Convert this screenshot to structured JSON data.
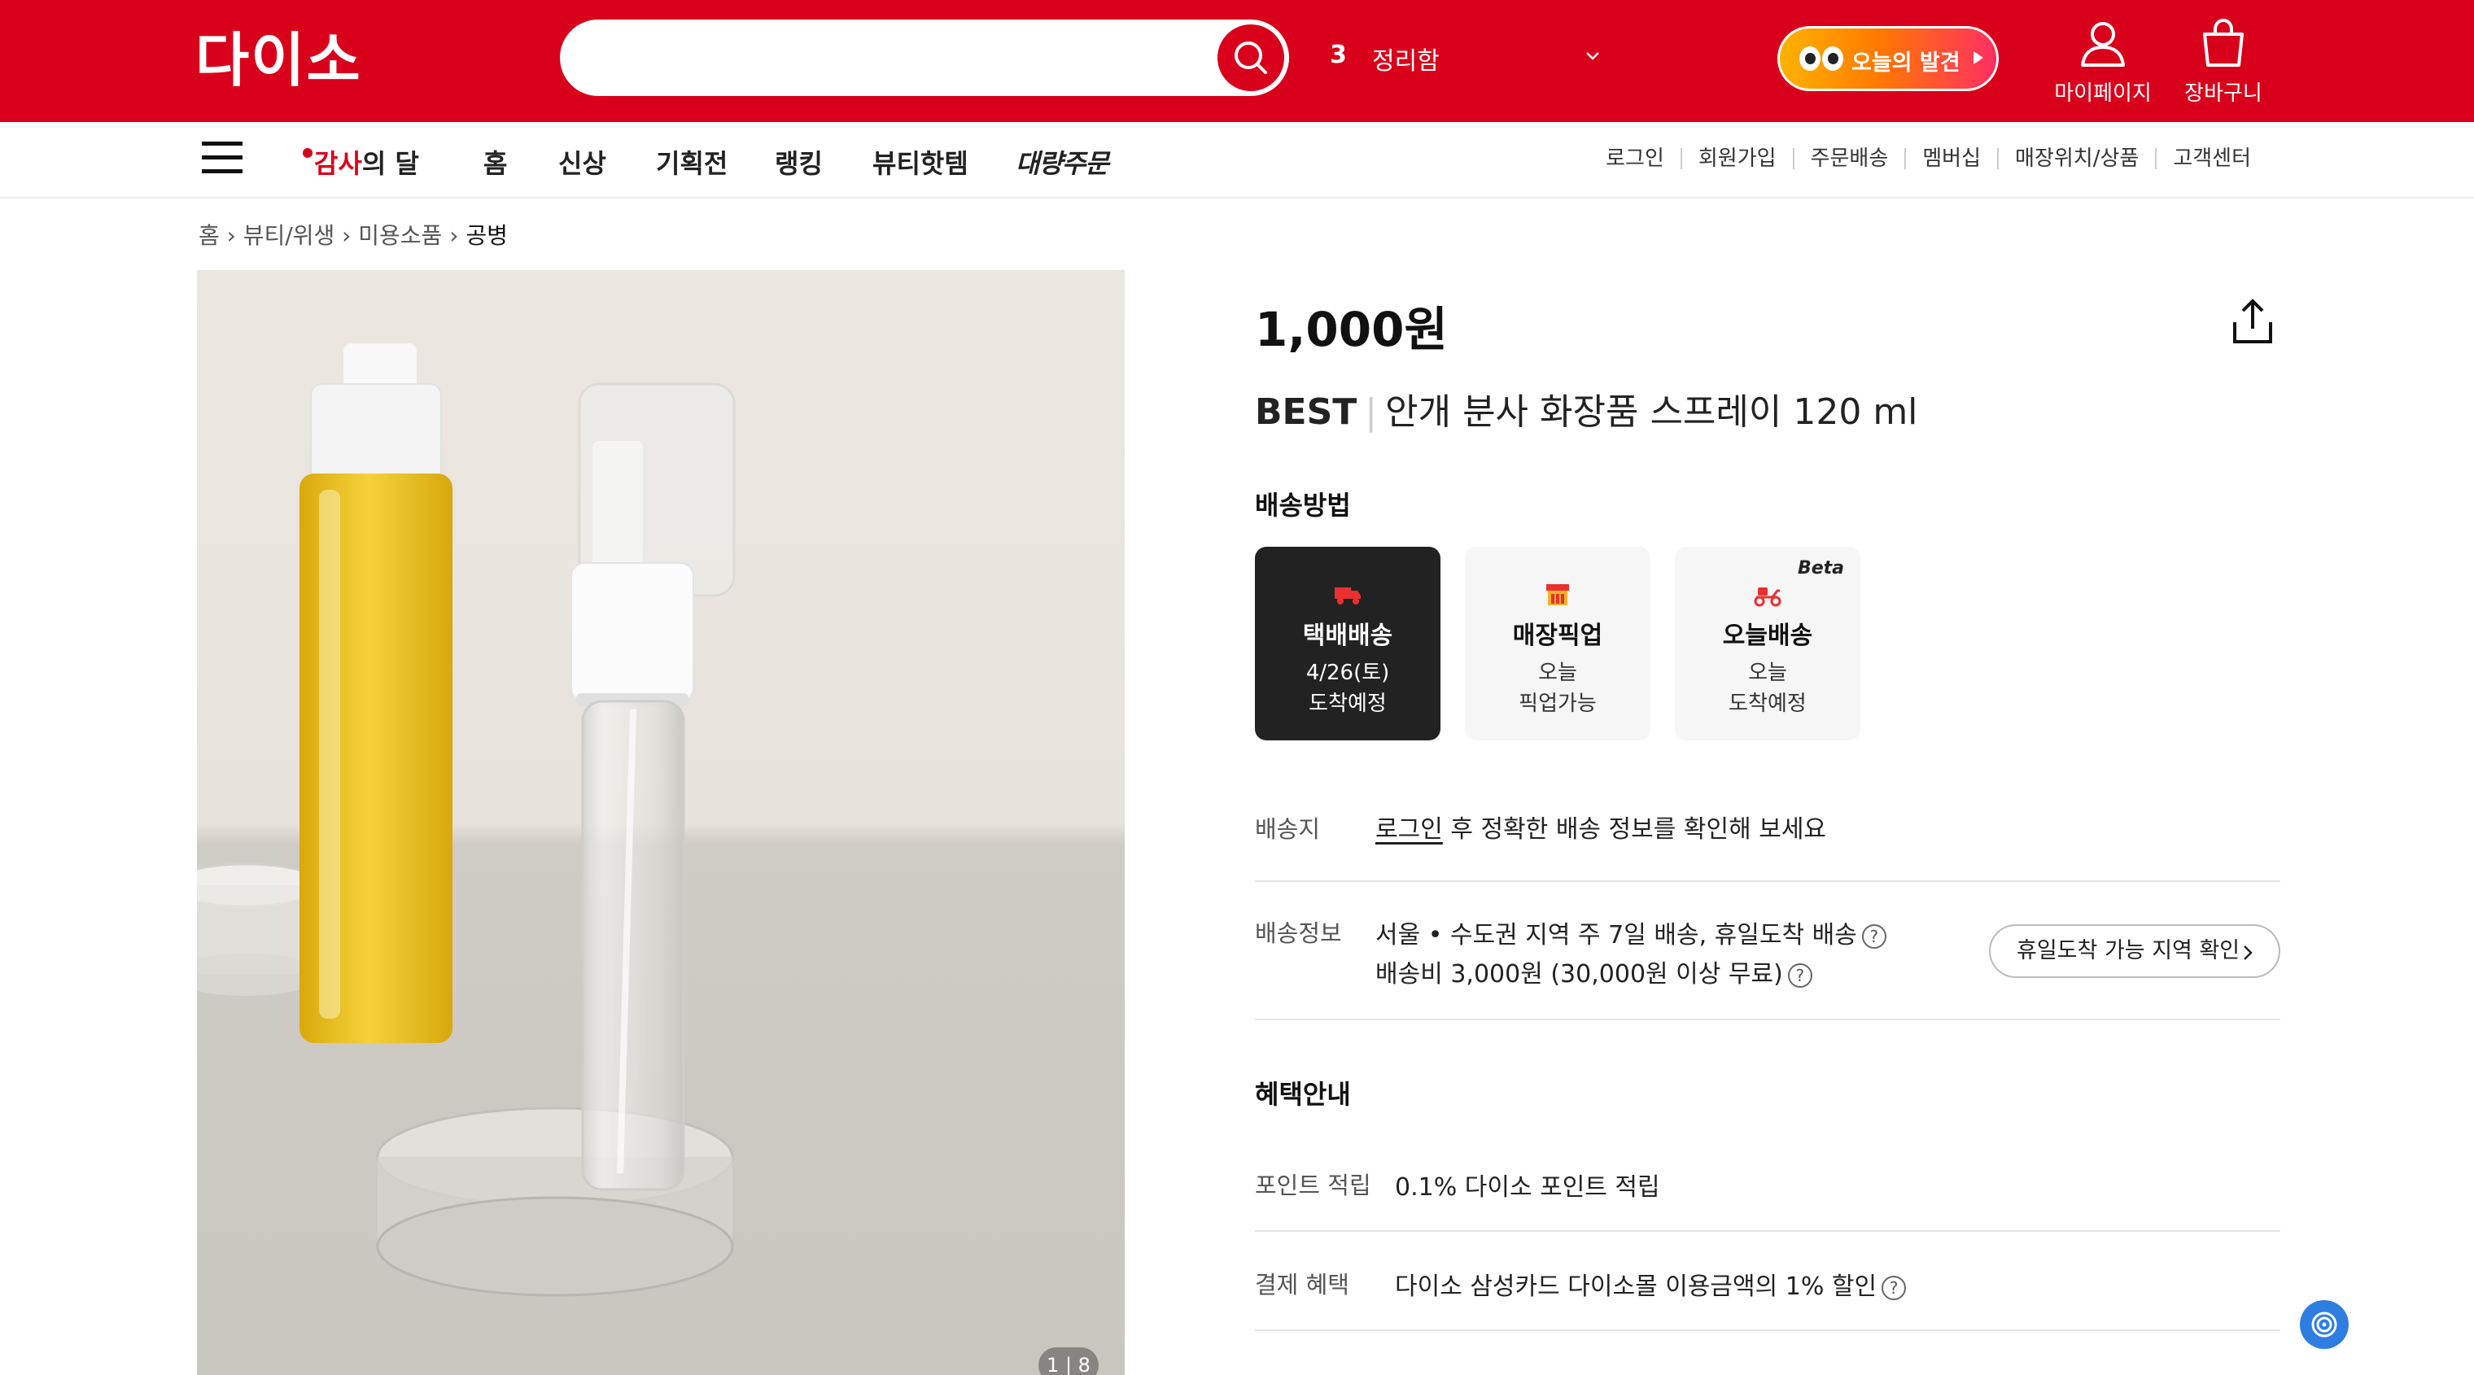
{
  "header": {
    "logo": "다이소",
    "search_placeholder": "",
    "rank_number": "3",
    "rank_keyword": "정리함",
    "today_badge": "오늘의 발견",
    "mypage": "마이페이지",
    "cart": "장바구니",
    "brand_color": "#d9001b"
  },
  "nav": {
    "promo_red": "감사",
    "promo_black": "의 달",
    "items": [
      "홈",
      "신상",
      "기획전",
      "랭킹",
      "뷰티핫템",
      "대량주문"
    ],
    "utility": [
      "로그인",
      "회원가입",
      "주문배송",
      "멤버십",
      "매장위치/상품",
      "고객센터"
    ]
  },
  "breadcrumb": [
    "홈",
    "뷰티/위생",
    "미용소품",
    "공병"
  ],
  "product": {
    "image_counter": "1 | 8",
    "price": "1,000원",
    "badge": "BEST",
    "name": "안개 분사 화장품 스프레이 120 ml"
  },
  "delivery": {
    "heading": "배송방법",
    "options": [
      {
        "name": "택배배송",
        "line1": "4/26(토)",
        "line2": "도착예정",
        "icon": "truck-icon",
        "active": true
      },
      {
        "name": "매장픽업",
        "line1": "오늘",
        "line2": "픽업가능",
        "icon": "store-icon",
        "active": false
      },
      {
        "name": "오늘배송",
        "line1": "오늘",
        "line2": "도착예정",
        "icon": "scooter-icon",
        "active": false,
        "tag": "Beta"
      }
    ],
    "dest_label": "배송지",
    "dest_link": "로그인",
    "dest_text": " 후 정확한 배송 정보를 확인해 보세요",
    "info_label": "배송정보",
    "info_line1": "서울 • 수도권 지역 주 7일 배송, 휴일도착 배송",
    "info_line2": "배송비 3,000원 (30,000원 이상 무료)",
    "holiday_button": "휴일도착 가능 지역 확인"
  },
  "benefits": {
    "heading": "혜택안내",
    "point_label": "포인트 적립",
    "point_text": "0.1% 다이소 포인트 적립",
    "pay_label": "결제 혜택",
    "pay_text": "다이소 삼성카드 다이소몰 이용금액의 1% 할인"
  }
}
